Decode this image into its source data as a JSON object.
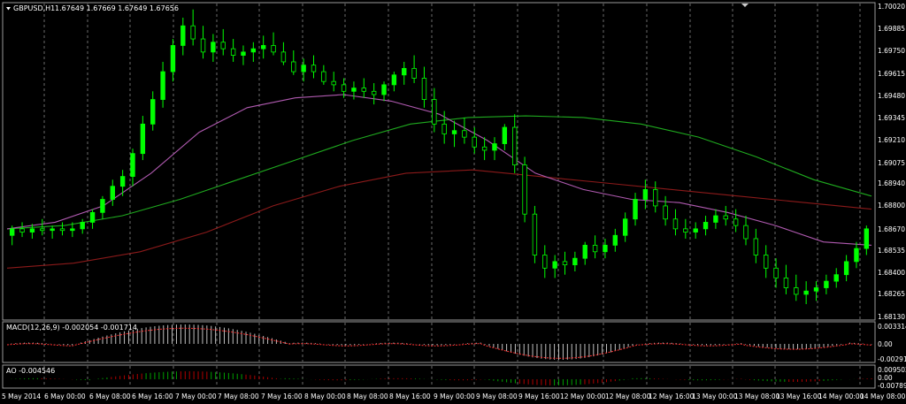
{
  "main": {
    "header_symbol": "GBPUSD,H1",
    "header_ohlc": "1.67649 1.67669 1.67649 1.67656",
    "price_axis": [
      "1.70020",
      "1.69885",
      "1.69750",
      "1.69615",
      "1.69480",
      "1.69345",
      "1.69210",
      "1.69075",
      "1.68940",
      "1.68800",
      "1.68670",
      "1.68535",
      "1.68400",
      "1.68265",
      "1.68130"
    ]
  },
  "macd": {
    "label": "MACD(12,26,9) -0.002054 -0.001714",
    "axis": [
      "0.003314",
      "0.00",
      "-0.00291"
    ]
  },
  "ao": {
    "label": "AO -0.004546",
    "axis": [
      "0.009502",
      "0.00",
      "-0.00789"
    ]
  },
  "time_axis": [
    "5 May 2014",
    "6 May 00:00",
    "6 May 08:00",
    "6 May 16:00",
    "7 May 00:00",
    "7 May 08:00",
    "7 May 16:00",
    "8 May 00:00",
    "8 May 08:00",
    "8 May 16:00",
    "9 May 00:00",
    "9 May 08:00",
    "9 May 16:00",
    "12 May 00:00",
    "12 May 08:00",
    "12 May 16:00",
    "13 May 00:00",
    "13 May 08:00",
    "13 May 16:00",
    "14 May 00:00",
    "14 May 08:00"
  ],
  "colors": {
    "bull": "#00ff00",
    "bear": "#000000",
    "ma_fast": "#b05ab0",
    "ma_mid": "#1faa1f",
    "ma_slow": "#8b1a1a",
    "macd_hist": "#c0c0c0",
    "macd_signal": "#ff3030",
    "ao_up": "#00a000",
    "ao_down": "#b00000",
    "grid": "#888888"
  },
  "chart_data": {
    "type": "candlestick",
    "candles": [
      [
        1.6862,
        1.6868,
        1.6856,
        1.6866
      ],
      [
        1.6866,
        1.687,
        1.6861,
        1.6864
      ],
      [
        1.6864,
        1.6869,
        1.686,
        1.6866
      ],
      [
        1.6866,
        1.6872,
        1.6862,
        1.6865
      ],
      [
        1.6865,
        1.6868,
        1.686,
        1.6866
      ],
      [
        1.6866,
        1.687,
        1.6862,
        1.6865
      ],
      [
        1.6865,
        1.687,
        1.6861,
        1.6866
      ],
      [
        1.6866,
        1.6872,
        1.6863,
        1.687
      ],
      [
        1.687,
        1.6878,
        1.6866,
        1.6876
      ],
      [
        1.6876,
        1.6886,
        1.6872,
        1.6884
      ],
      [
        1.6884,
        1.6896,
        1.688,
        1.6892
      ],
      [
        1.6892,
        1.6902,
        1.6886,
        1.6898
      ],
      [
        1.6898,
        1.6915,
        1.6892,
        1.6912
      ],
      [
        1.6912,
        1.6935,
        1.6908,
        1.693
      ],
      [
        1.693,
        1.695,
        1.6926,
        1.6945
      ],
      [
        1.6945,
        1.6968,
        1.694,
        1.6962
      ],
      [
        1.6962,
        1.6982,
        1.6956,
        1.6978
      ],
      [
        1.6978,
        1.6995,
        1.6972,
        1.699
      ],
      [
        1.699,
        1.7,
        1.6978,
        1.6982
      ],
      [
        1.6982,
        1.699,
        1.697,
        1.6974
      ],
      [
        1.6974,
        1.6985,
        1.6968,
        1.698
      ],
      [
        1.698,
        1.6988,
        1.6972,
        1.6976
      ],
      [
        1.6976,
        1.6982,
        1.6968,
        1.6972
      ],
      [
        1.6972,
        1.6978,
        1.6966,
        1.6974
      ],
      [
        1.6974,
        1.698,
        1.6968,
        1.6976
      ],
      [
        1.6976,
        1.6984,
        1.697,
        1.6978
      ],
      [
        1.6978,
        1.6986,
        1.6972,
        1.6974
      ],
      [
        1.6974,
        1.698,
        1.6966,
        1.6968
      ],
      [
        1.6968,
        1.6975,
        1.696,
        1.6962
      ],
      [
        1.6962,
        1.697,
        1.6956,
        1.6966
      ],
      [
        1.6966,
        1.6972,
        1.6958,
        1.6962
      ],
      [
        1.6962,
        1.6966,
        1.6954,
        1.6956
      ],
      [
        1.6956,
        1.6962,
        1.695,
        1.6954
      ],
      [
        1.6954,
        1.6958,
        1.6946,
        1.695
      ],
      [
        1.695,
        1.6956,
        1.6945,
        1.6952
      ],
      [
        1.6952,
        1.6958,
        1.6946,
        1.695
      ],
      [
        1.695,
        1.6955,
        1.6942,
        1.6948
      ],
      [
        1.6948,
        1.6956,
        1.6944,
        1.6954
      ],
      [
        1.6954,
        1.6962,
        1.695,
        1.696
      ],
      [
        1.696,
        1.6968,
        1.6954,
        1.6964
      ],
      [
        1.6964,
        1.6972,
        1.6955,
        1.6958
      ],
      [
        1.6958,
        1.6965,
        1.694,
        1.6945
      ],
      [
        1.6945,
        1.6952,
        1.6925,
        1.693
      ],
      [
        1.693,
        1.6938,
        1.6918,
        1.6924
      ],
      [
        1.6924,
        1.6932,
        1.6916,
        1.6926
      ],
      [
        1.6926,
        1.6934,
        1.6918,
        1.6922
      ],
      [
        1.6922,
        1.6928,
        1.6912,
        1.6916
      ],
      [
        1.6916,
        1.6922,
        1.6908,
        1.6914
      ],
      [
        1.6914,
        1.6922,
        1.6908,
        1.6918
      ],
      [
        1.6918,
        1.693,
        1.6914,
        1.6928
      ],
      [
        1.6928,
        1.6936,
        1.69,
        1.6905
      ],
      [
        1.6905,
        1.691,
        1.687,
        1.6875
      ],
      [
        1.6875,
        1.688,
        1.6845,
        1.685
      ],
      [
        1.685,
        1.6856,
        1.6836,
        1.6842
      ],
      [
        1.6842,
        1.685,
        1.6836,
        1.6846
      ],
      [
        1.6846,
        1.6852,
        1.6838,
        1.6844
      ],
      [
        1.6844,
        1.6852,
        1.684,
        1.6848
      ],
      [
        1.6848,
        1.6858,
        1.6844,
        1.6856
      ],
      [
        1.6856,
        1.6862,
        1.6848,
        1.6852
      ],
      [
        1.6852,
        1.686,
        1.6848,
        1.6856
      ],
      [
        1.6856,
        1.6866,
        1.6852,
        1.6862
      ],
      [
        1.6862,
        1.6876,
        1.6858,
        1.6872
      ],
      [
        1.6872,
        1.6888,
        1.6868,
        1.6884
      ],
      [
        1.6884,
        1.6896,
        1.6878,
        1.689
      ],
      [
        1.689,
        1.6895,
        1.6876,
        1.688
      ],
      [
        1.688,
        1.6886,
        1.6868,
        1.6872
      ],
      [
        1.6872,
        1.6878,
        1.6862,
        1.6866
      ],
      [
        1.6866,
        1.6872,
        1.686,
        1.6864
      ],
      [
        1.6864,
        1.687,
        1.686,
        1.6866
      ],
      [
        1.6866,
        1.6874,
        1.6862,
        1.687
      ],
      [
        1.687,
        1.6878,
        1.6866,
        1.6874
      ],
      [
        1.6874,
        1.688,
        1.6868,
        1.6872
      ],
      [
        1.6872,
        1.6878,
        1.6864,
        1.6868
      ],
      [
        1.6868,
        1.6874,
        1.6856,
        1.686
      ],
      [
        1.686,
        1.6866,
        1.6845,
        1.685
      ],
      [
        1.685,
        1.6856,
        1.6836,
        1.6842
      ],
      [
        1.6842,
        1.6848,
        1.683,
        1.6836
      ],
      [
        1.6836,
        1.6844,
        1.6826,
        1.683
      ],
      [
        1.683,
        1.6838,
        1.6822,
        1.6826
      ],
      [
        1.6826,
        1.6834,
        1.682,
        1.6828
      ],
      [
        1.6828,
        1.6834,
        1.6822,
        1.683
      ],
      [
        1.683,
        1.6838,
        1.6826,
        1.6834
      ],
      [
        1.6834,
        1.6842,
        1.683,
        1.6838
      ],
      [
        1.6838,
        1.685,
        1.6834,
        1.6846
      ],
      [
        1.6846,
        1.6858,
        1.6842,
        1.6854
      ],
      [
        1.6854,
        1.6868,
        1.685,
        1.6866
      ]
    ],
    "ma_fast": [
      1.6866,
      1.687,
      1.688,
      1.69,
      1.6925,
      1.694,
      1.6946,
      1.6948,
      1.6944,
      1.6936,
      1.692,
      1.69,
      1.689,
      1.6884,
      1.6882,
      1.6876,
      1.6868,
      1.6858,
      1.6856
    ],
    "ma_mid": [
      1.6866,
      1.6868,
      1.6874,
      1.6884,
      1.6896,
      1.6908,
      1.692,
      1.693,
      1.6934,
      1.6935,
      1.6934,
      1.693,
      1.6922,
      1.691,
      1.6896,
      1.6886
    ],
    "ma_slow": [
      1.6842,
      1.6845,
      1.6852,
      1.6864,
      1.688,
      1.6892,
      1.69,
      1.6902,
      1.6898,
      1.6894,
      1.689,
      1.6886,
      1.6882,
      1.6878
    ]
  }
}
